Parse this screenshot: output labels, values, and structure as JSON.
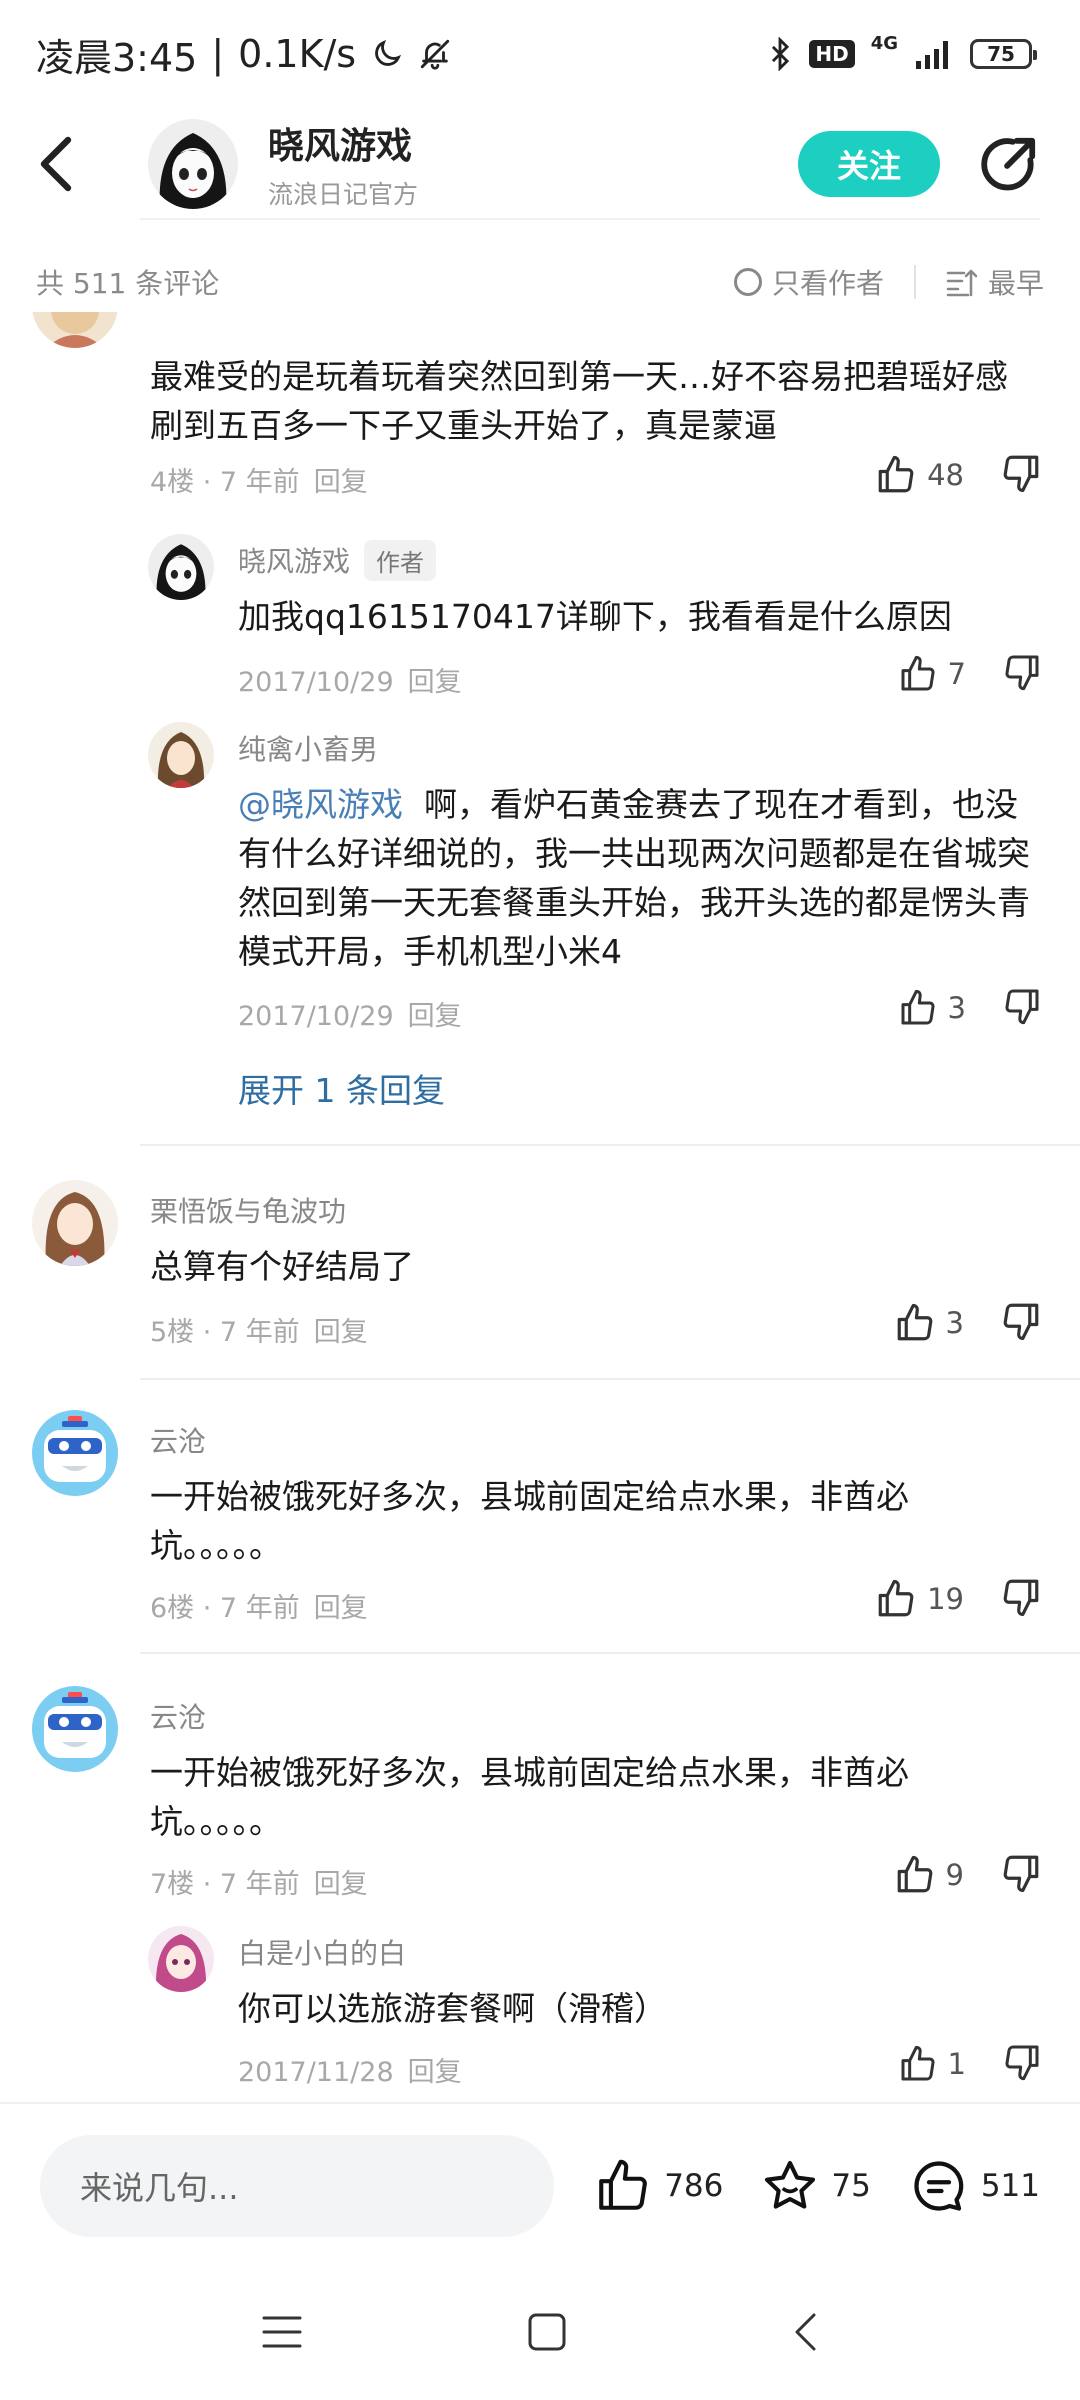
{
  "status_bar": {
    "time": "凌晨3:45",
    "speed": "0.1K/s",
    "network": "4G",
    "battery": "75",
    "hd": "HD"
  },
  "header": {
    "title": "晓风游戏",
    "subtitle": "流浪日记官方",
    "follow_label": "关注"
  },
  "filter": {
    "count": "共 511 条评论",
    "only_author": "只看作者",
    "sort": "最早"
  },
  "comments": [
    {
      "text": "最难受的是玩着玩着突然回到第一天…好不容易把碧瑶好感刷到五百多一下子又重头开始了，真是蒙逼",
      "meta": "4楼 · 7 年前",
      "reply": "回复",
      "likes": "48"
    },
    {
      "name": "晓风游戏",
      "tag": "作者",
      "text": "加我qq1615170417详聊下，我看看是什么原因",
      "meta": "2017/10/29",
      "reply": "回复",
      "likes": "7"
    },
    {
      "name": "纯禽小畜男",
      "mention": "@晓风游戏",
      "text": "啊，看炉石黄金赛去了现在才看到，也没有什么好详细说的，我一共出现两次问题都是在省城突然回到第一天无套餐重头开始，我开头选的都是愣头青模式开局，手机机型小米4",
      "meta": "2017/10/29",
      "reply": "回复",
      "likes": "3"
    },
    {
      "name": "栗悟饭与龟波功",
      "text": "总算有个好结局了",
      "meta": "5楼 · 7 年前",
      "reply": "回复",
      "likes": "3"
    },
    {
      "name": "云沧",
      "text": "一开始被饿死好多次，县城前固定给点水果，非酋必坑。。。。。",
      "meta": "6楼 · 7 年前",
      "reply": "回复",
      "likes": "19"
    },
    {
      "name": "云沧",
      "text": "一开始被饿死好多次，县城前固定给点水果，非酋必坑。。。。。",
      "meta": "7楼 · 7 年前",
      "reply": "回复",
      "likes": "9"
    },
    {
      "name": "白是小白的白",
      "text": "你可以选旅游套餐啊（滑稽）",
      "meta": "2017/11/28",
      "reply": "回复",
      "likes": "1"
    }
  ],
  "expand_label": "展开 1 条回复",
  "bottom": {
    "placeholder": "来说几句...",
    "likes": "786",
    "stars": "75",
    "comments": "511"
  }
}
